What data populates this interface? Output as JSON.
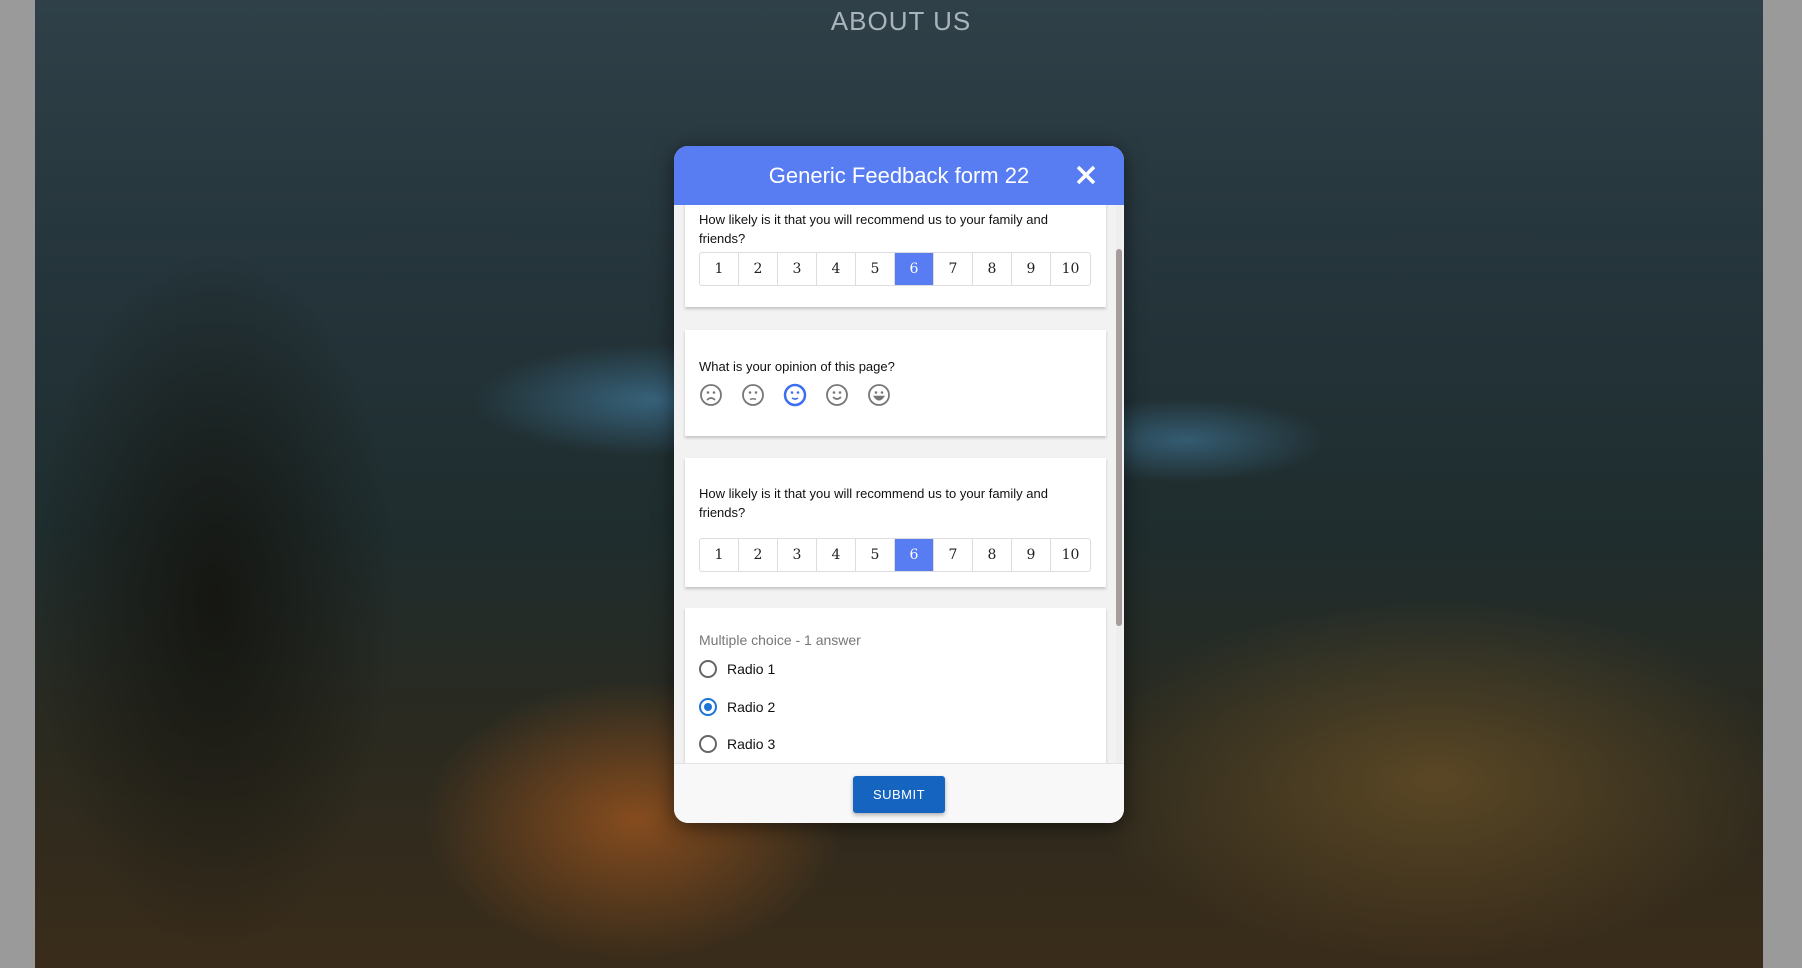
{
  "page": {
    "heading": "ABOUT US"
  },
  "modal": {
    "title": "Generic Feedback form 22",
    "close_icon": "close-icon",
    "q1": {
      "text": "How likely is it that you will recommend us to your family and friends?",
      "options": [
        "1",
        "2",
        "3",
        "4",
        "5",
        "6",
        "7",
        "8",
        "9",
        "10"
      ],
      "selected": "6"
    },
    "q2": {
      "text": "What is your opinion of this page?",
      "faces": [
        "very-sad-face-icon",
        "sad-face-icon",
        "neutral-face-icon",
        "happy-face-icon",
        "very-happy-face-icon"
      ],
      "selected_index": 2
    },
    "q3": {
      "text": "How likely is it that you will recommend us to your family and friends?",
      "options": [
        "1",
        "2",
        "3",
        "4",
        "5",
        "6",
        "7",
        "8",
        "9",
        "10"
      ],
      "selected": "6"
    },
    "q4": {
      "label": "Multiple choice - 1 answer",
      "options": [
        "Radio 1",
        "Radio 2",
        "Radio 3"
      ],
      "selected": "Radio 2"
    },
    "submit": "SUBMIT",
    "colors": {
      "accent": "#587cf2",
      "submit": "#1565c0",
      "radio": "#1e74d6"
    }
  }
}
